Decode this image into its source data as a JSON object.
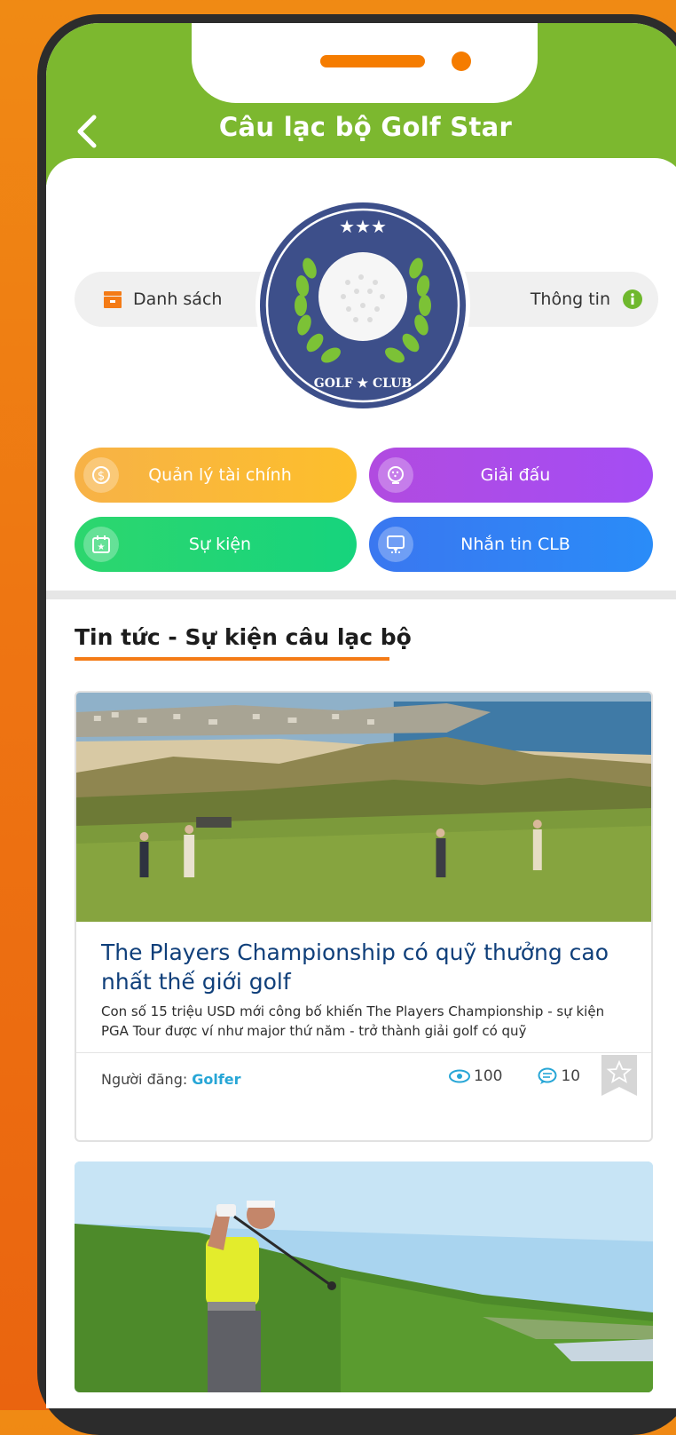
{
  "header": {
    "title": "Câu lạc bộ Golf Star",
    "back_icon": "chevron-left-icon"
  },
  "club": {
    "list_label": "Danh sách",
    "info_label": "Thông tin",
    "logo_top_text": "★★★",
    "logo_bottom_text": "GOLF ★ CLUB"
  },
  "actions": [
    {
      "label": "Quản lý tài chính",
      "icon": "finance-icon",
      "color": "#fdbf2b"
    },
    {
      "label": "Giải đấu",
      "icon": "golf-ball-icon",
      "color": "#a44df4"
    },
    {
      "label": "Sự kiện",
      "icon": "calendar-icon",
      "color": "#16d47d"
    },
    {
      "label": "Nhắn tin CLB",
      "icon": "chat-icon",
      "color": "#2a8cf8"
    }
  ],
  "news": {
    "section_title": "Tin tức - Sự kiện câu lạc bộ",
    "items": [
      {
        "title": "The Players Championship có quỹ thưởng cao nhất thế giới golf",
        "description": "Con số 15 triệu USD mới công bố khiến The Players Championship - sự kiện PGA Tour được ví như major thứ năm - trở thành giải golf có quỹ",
        "author_label": "Người đăng:",
        "author": "Golfer",
        "views": "100",
        "comments": "10"
      }
    ]
  },
  "colors": {
    "header_green": "#7cb82f",
    "accent_orange": "#f47b16",
    "link_blue": "#27a6d6"
  }
}
